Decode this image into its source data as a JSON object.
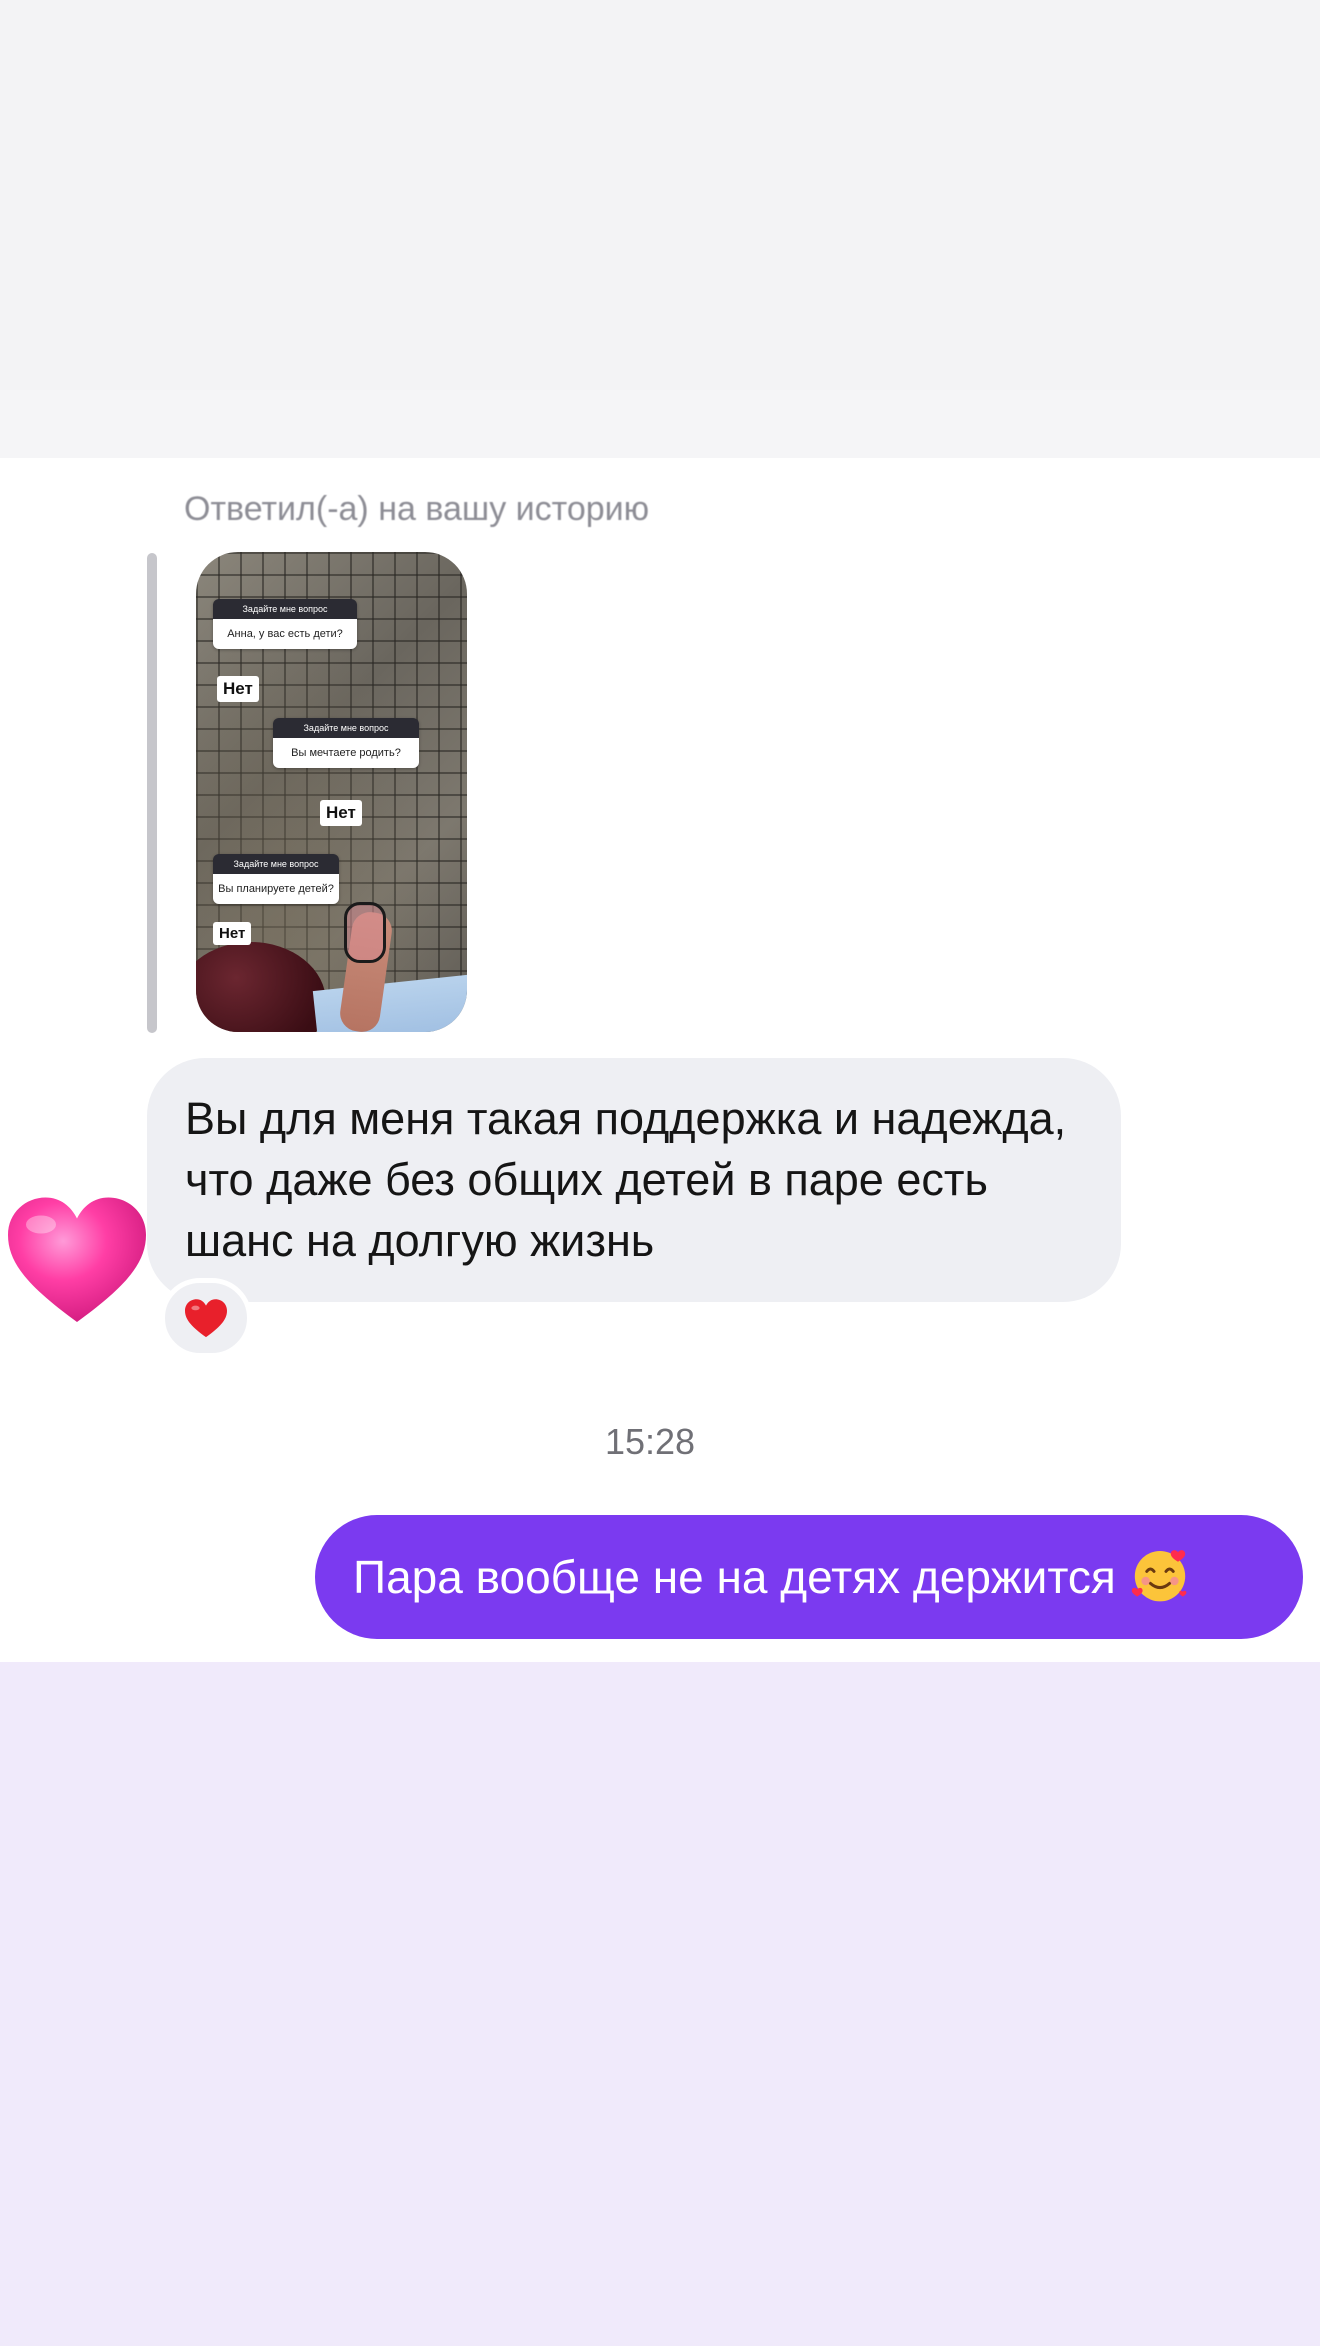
{
  "conversation": {
    "reply_context": {
      "label": "Ответил(-а) на вашу историю",
      "story": {
        "questions": [
          {
            "header": "Задайте мне вопрос",
            "question": "Анна, у вас есть дети?",
            "answer": "Нет"
          },
          {
            "header": "Задайте мне вопрос",
            "question": "Вы мечтаете родить?",
            "answer": "Нет"
          },
          {
            "header": "Задайте мне вопрос",
            "question": "Вы планируете детей?",
            "answer": "Нет"
          }
        ]
      }
    },
    "incoming_message": {
      "text": "Вы для меня такая поддержка и надежда, что даже без общих детей в паре есть шанс на долгую жизнь",
      "sticker": "pink-heart-icon",
      "reaction": "red-heart-icon"
    },
    "timestamp": "15:28",
    "outgoing_message": {
      "text": "Пара вообще не на детях держится",
      "emoji": "smiling-face-with-hearts-icon"
    }
  },
  "colors": {
    "incoming_bubble": "#eeeff3",
    "outgoing_bubble": "#7b3af0",
    "reply_bar": "#c6c6cb",
    "bottom_background": "#f0eafb",
    "sticker_heart": "#ff3ea5",
    "reaction_heart": "#e8202b"
  }
}
